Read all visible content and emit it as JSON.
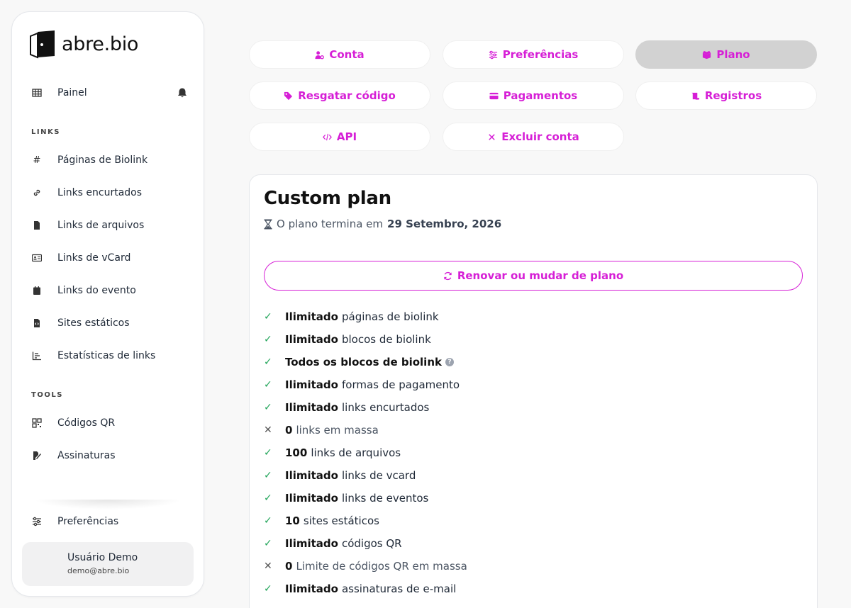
{
  "brand": {
    "name": "abre.bio"
  },
  "sidebar": {
    "dashboard": "Painel",
    "links_label": "LINKS",
    "links": [
      {
        "label": "Páginas de Biolink",
        "icon": "hash-icon"
      },
      {
        "label": "Links encurtados",
        "icon": "link-icon"
      },
      {
        "label": "Links de arquivos",
        "icon": "file-icon"
      },
      {
        "label": "Links de vCard",
        "icon": "id-card-icon"
      },
      {
        "label": "Links do evento",
        "icon": "calendar-icon"
      },
      {
        "label": "Sites estáticos",
        "icon": "file-code-icon"
      },
      {
        "label": "Estatísticas de links",
        "icon": "chart-icon"
      }
    ],
    "tools_label": "TOOLS",
    "tools": [
      {
        "label": "Códigos QR",
        "icon": "qr-icon"
      },
      {
        "label": "Assinaturas",
        "icon": "signature-icon"
      }
    ],
    "preferences": "Preferências",
    "user": {
      "name": "Usuário Demo",
      "email": "demo@abre.bio"
    }
  },
  "tabs": [
    {
      "label": "Conta",
      "icon": "user-cog-icon"
    },
    {
      "label": "Preferências",
      "icon": "sliders-icon"
    },
    {
      "label": "Plano",
      "icon": "box-icon",
      "active": true
    },
    {
      "label": "Resgatar código",
      "icon": "tag-icon"
    },
    {
      "label": "Pagamentos",
      "icon": "credit-card-icon"
    },
    {
      "label": "Registros",
      "icon": "scroll-icon"
    },
    {
      "label": "API",
      "icon": "code-icon"
    },
    {
      "label": "Excluir conta",
      "icon": "x-icon"
    }
  ],
  "plan": {
    "title": "Custom plan",
    "ends_prefix": "O plano termina em",
    "ends_date": "29 Setembro, 2026",
    "renew_label": "Renovar ou mudar de plano",
    "features": [
      {
        "bold": "Ilimitado",
        "text": "páginas de biolink",
        "ok": true
      },
      {
        "bold": "Ilimitado",
        "text": "blocos de biolink",
        "ok": true
      },
      {
        "bold": "Todos os blocos de biolink",
        "text": "",
        "ok": true,
        "help": true
      },
      {
        "bold": "Ilimitado",
        "text": "formas de pagamento",
        "ok": true
      },
      {
        "bold": "Ilimitado",
        "text": "links encurtados",
        "ok": true
      },
      {
        "bold": "0",
        "text": "links em massa",
        "ok": false
      },
      {
        "bold": "100",
        "text": "links de arquivos",
        "ok": true
      },
      {
        "bold": "Ilimitado",
        "text": "links de vcard",
        "ok": true
      },
      {
        "bold": "Ilimitado",
        "text": "links de eventos",
        "ok": true
      },
      {
        "bold": "10",
        "text": "sites estáticos",
        "ok": true
      },
      {
        "bold": "Ilimitado",
        "text": "códigos QR",
        "ok": true
      },
      {
        "bold": "0",
        "text": "Limite de códigos QR em massa",
        "ok": false
      },
      {
        "bold": "Ilimitado",
        "text": "assinaturas de e-mail",
        "ok": true
      }
    ]
  },
  "colors": {
    "accent": "#d61fd6",
    "check": "#22a55a",
    "active_tab": "#d2d2d2"
  }
}
